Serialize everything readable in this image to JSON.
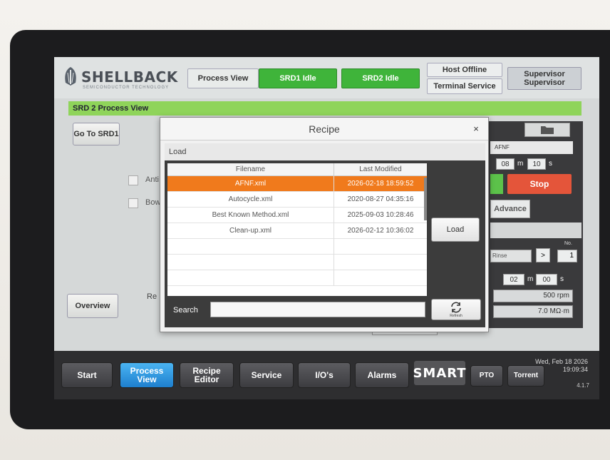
{
  "header": {
    "logo_name": "SHELLBACK",
    "logo_tagline": "SEMICONDUCTOR TECHNOLOGY",
    "process_view": "Process View",
    "srd1_status": "SRD1 Idle",
    "srd2_status": "SRD2 Idle",
    "host_status": "Host Offline",
    "terminal_service": "Terminal Service",
    "user_line1": "Supervisor",
    "user_line2": "Supervisor"
  },
  "page_title": "SRD 2 Process View",
  "left": {
    "go_to_label": "Go To SRD1",
    "overview_label": "Overview",
    "cb1_label": "Anti",
    "cb2_label": "Bow",
    "re_label": "Re"
  },
  "right_panel": {
    "recipe_name": "AFNF",
    "time_min": "08",
    "time_sec": "10",
    "unit_m": "m",
    "unit_s": "s",
    "stop_label": "Stop",
    "advance_label": "Advance",
    "no_label": "No.",
    "step_name": "Rinse",
    "step_next": ">",
    "step_no": "1",
    "step_time_min": "02",
    "step_time_sec": "00",
    "rpm": "500 rpm",
    "resistivity": "7.0 MΩ·m"
  },
  "dialog": {
    "title": "Recipe",
    "close": "×",
    "section": "Load",
    "columns": [
      "Filename",
      "Last Modified"
    ],
    "rows": [
      {
        "filename": "AFNF.xml",
        "modified": "2026-02-18 18:59:52",
        "selected": true
      },
      {
        "filename": "Autocycle.xml",
        "modified": "2020-08-27 04:35:16",
        "selected": false
      },
      {
        "filename": "Best Known Method.xml",
        "modified": "2025-09-03 10:28:46",
        "selected": false
      },
      {
        "filename": "Clean-up.xml",
        "modified": "2026-02-12 10:36:02",
        "selected": false
      }
    ],
    "load_label": "Load",
    "search_label": "Search",
    "search_value": "",
    "refresh_caption": "Refresh"
  },
  "footer": {
    "start": "Start",
    "process_view_1": "Process",
    "process_view_2": "View",
    "recipe_editor_1": "Recipe",
    "recipe_editor_2": "Editor",
    "service": "Service",
    "ios": "I/O's",
    "alarms": "Alarms",
    "smart": "SMART",
    "pto": "PTO",
    "torrent": "Torrent",
    "date": "Wed, Feb 18 2026",
    "time": "19:09:34",
    "version": "4.1.7"
  },
  "colors": {
    "status_green": "#3fb43a",
    "title_green": "#8fd45a",
    "selected_row": "#f07a1c",
    "stop_red": "#e4553a",
    "active_nav": "#2a94e0"
  }
}
